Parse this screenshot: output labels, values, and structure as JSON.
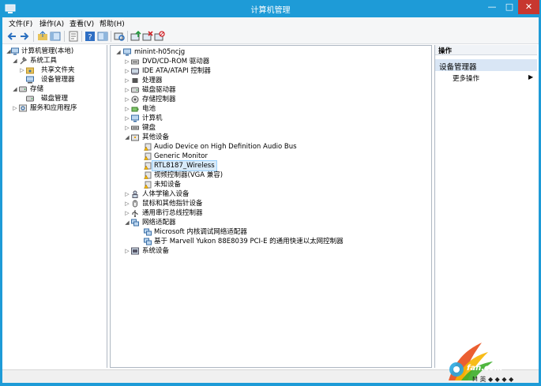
{
  "window": {
    "title": "计算机管理",
    "min": "—",
    "max": "□",
    "close": "✕"
  },
  "menu": [
    "文件(F)",
    "操作(A)",
    "查看(V)",
    "帮助(H)"
  ],
  "left_tree": {
    "root": "计算机管理(本地)",
    "system_tools": "系统工具",
    "shared_folders": "共享文件夹",
    "device_manager": "设备管理器",
    "storage": "存储",
    "disk_management": "磁盘管理",
    "services_apps": "服务和应用程序"
  },
  "device_tree": {
    "root": "minint-h05ncjg",
    "items": [
      {
        "label": "DVD/CD-ROM 驱动器",
        "icon": "dvd-drive-icon"
      },
      {
        "label": "IDE ATA/ATAPI 控制器",
        "icon": "ide-controller-icon"
      },
      {
        "label": "处理器",
        "icon": "processor-icon"
      },
      {
        "label": "磁盘驱动器",
        "icon": "disk-drive-icon"
      },
      {
        "label": "存储控制器",
        "icon": "storage-controller-icon"
      },
      {
        "label": "电池",
        "icon": "battery-icon"
      },
      {
        "label": "计算机",
        "icon": "computer-icon"
      },
      {
        "label": "键盘",
        "icon": "keyboard-icon"
      }
    ],
    "other_devices": "其他设备",
    "other_children": [
      "Audio Device on High Definition Audio Bus",
      "Generic Monitor",
      "RTL8187_Wireless",
      "视频控制器(VGA 兼容)",
      "未知设备"
    ],
    "items2": [
      {
        "label": "人体学输入设备",
        "icon": "hid-icon"
      },
      {
        "label": "鼠标和其他指针设备",
        "icon": "mouse-icon"
      },
      {
        "label": "通用串行总线控制器",
        "icon": "usb-icon"
      }
    ],
    "network_adapters": "网络适配器",
    "network_children": [
      "Microsoft 内核调试网络适配器",
      "基于 Marvell Yukon 88E8039 PCI-E 的通用快速以太网控制器"
    ],
    "system_devices": "系统设备"
  },
  "actions": {
    "header": "操作",
    "section": "设备管理器",
    "more": "更多操作",
    "arrow": "▶"
  },
  "watermark": {
    "text": "fan.com"
  },
  "tray": {
    "text": "M 英 ◆ ◆ ◆ ◆"
  }
}
